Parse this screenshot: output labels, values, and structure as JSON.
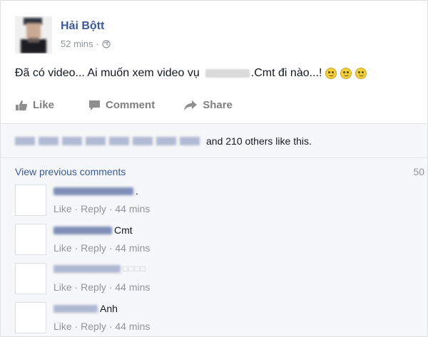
{
  "post": {
    "author": "Hải Bộtt",
    "timestamp": "52 mins",
    "separator": "·",
    "text_before": "Đã có video... Ai muốn xem video vụ",
    "text_after": ".Cmt đi nào...!",
    "emoji_count": 3
  },
  "actions": {
    "like": "Like",
    "comment": "Comment",
    "share": "Share"
  },
  "likes": {
    "others_text": "and 210 others like this."
  },
  "comments_section": {
    "view_previous": "View previous comments",
    "count": "50",
    "items": [
      {
        "text": ".",
        "like": "Like",
        "reply": "Reply",
        "time": "44 mins"
      },
      {
        "text": "Cmt",
        "like": "Like",
        "reply": "Reply",
        "time": "44 mins"
      },
      {
        "text": "□□□□",
        "like": "Like",
        "reply": "Reply",
        "time": "44 mins"
      },
      {
        "text": "Anh",
        "like": "Like",
        "reply": "Reply",
        "time": "44 mins"
      }
    ],
    "dot": " · "
  },
  "colors": {
    "brand": "#3b5998",
    "meta": "#90949c",
    "background": "#f6f7f9"
  }
}
